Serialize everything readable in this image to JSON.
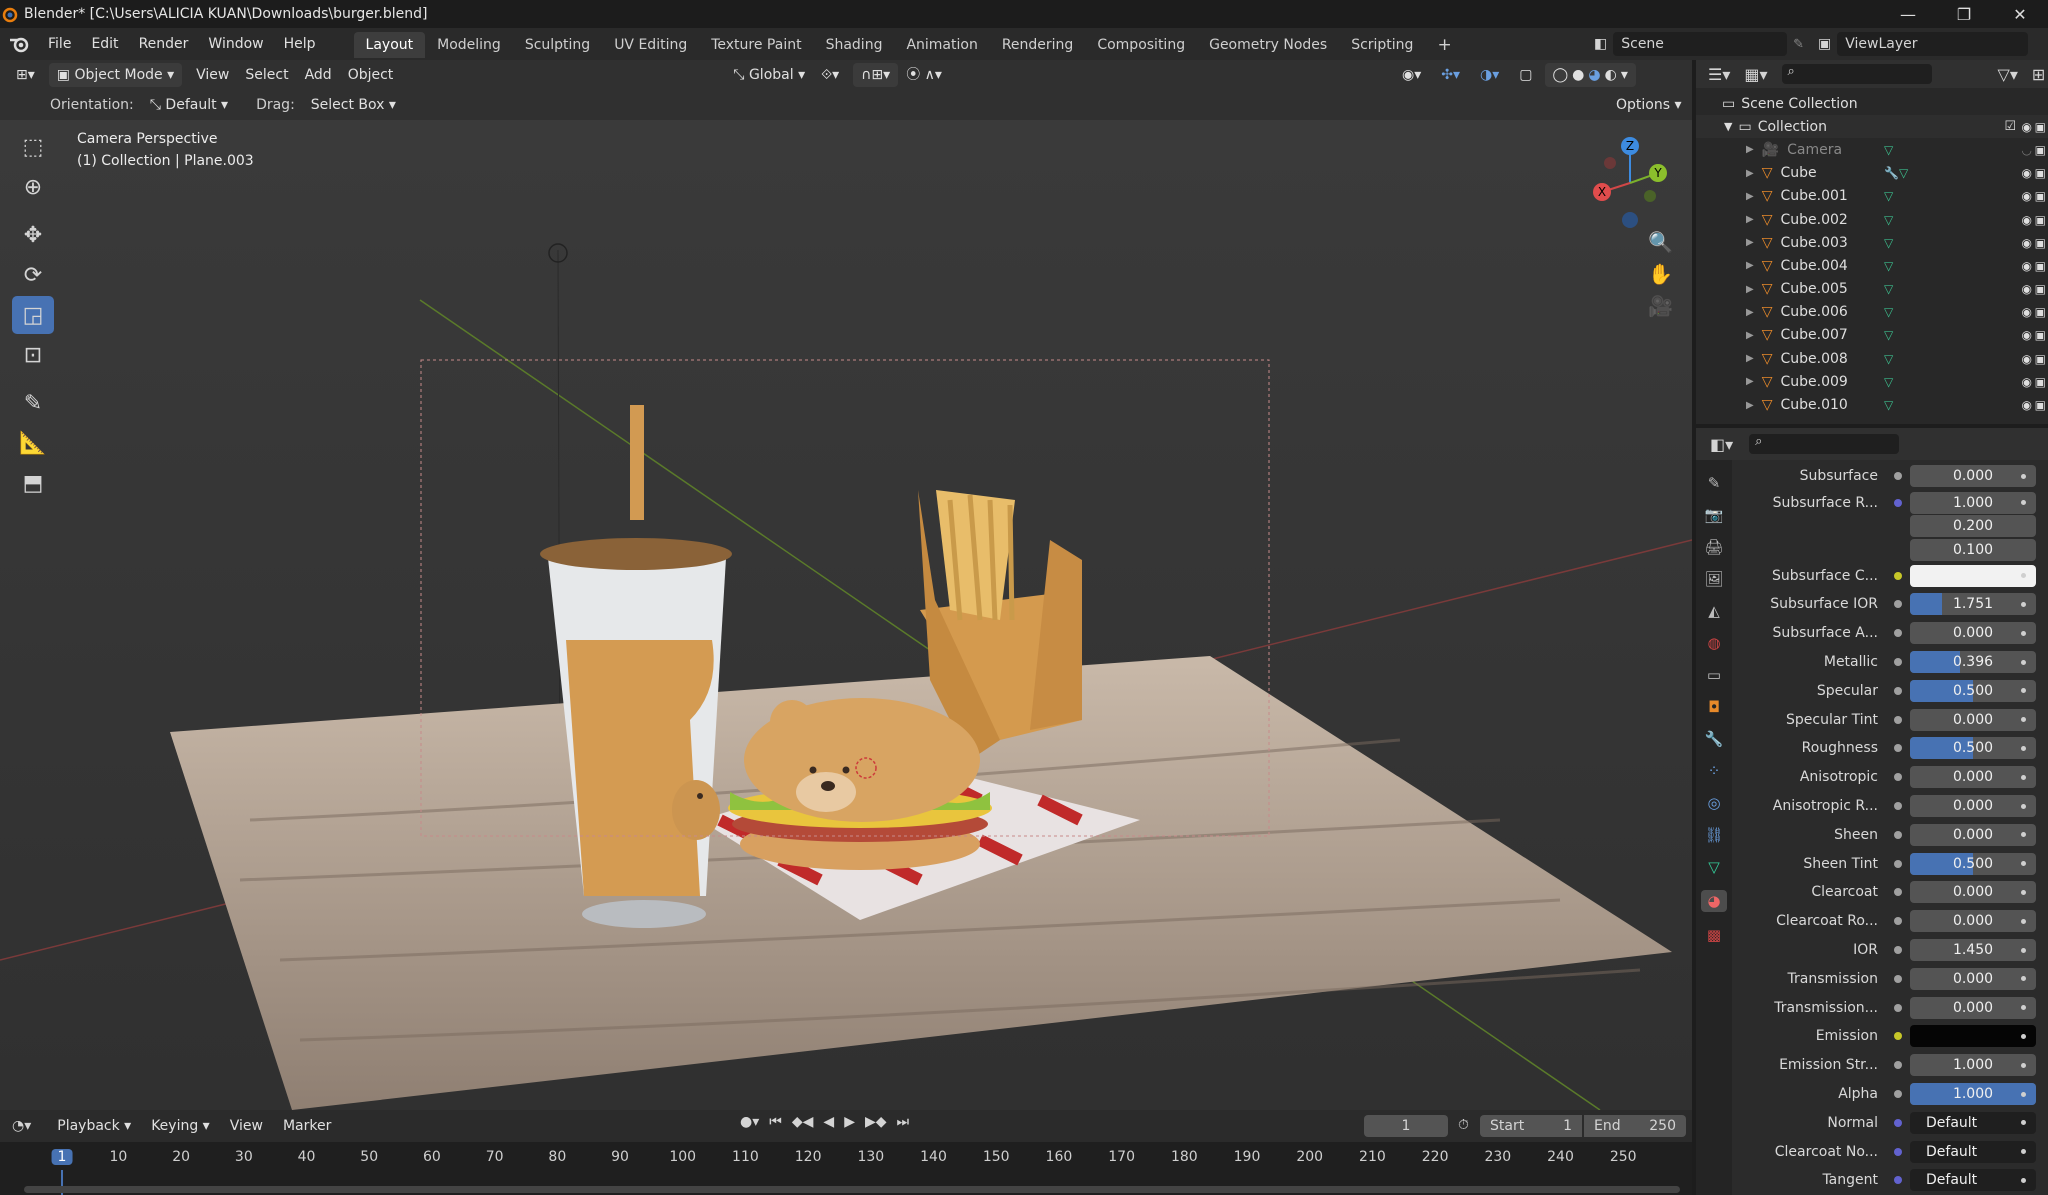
{
  "window": {
    "title": "Blender* [C:\\Users\\ALICIA KUAN\\Downloads\\burger.blend]"
  },
  "menu": {
    "items": [
      "File",
      "Edit",
      "Render",
      "Window",
      "Help"
    ]
  },
  "workspaces": {
    "tabs": [
      "Layout",
      "Modeling",
      "Sculpting",
      "UV Editing",
      "Texture Paint",
      "Shading",
      "Animation",
      "Rendering",
      "Compositing",
      "Geometry Nodes",
      "Scripting"
    ],
    "active": "Layout",
    "add": "+"
  },
  "scene": {
    "label": "Scene",
    "viewlayer": "ViewLayer"
  },
  "viewport_header": {
    "mode": "Object Mode",
    "menus": [
      "View",
      "Select",
      "Add",
      "Object"
    ],
    "transform": "Global"
  },
  "tool_header": {
    "orientation_label": "Orientation:",
    "orientation_value": "Default",
    "drag_label": "Drag:",
    "drag_value": "Select Box",
    "options": "Options"
  },
  "viewport": {
    "line1": "Camera Perspective",
    "line2": "(1) Collection | Plane.003",
    "gizmo": {
      "z": "Z",
      "y": "Y",
      "x": "X"
    }
  },
  "outliner": {
    "root": "Scene Collection",
    "collection": "Collection",
    "items": [
      "Camera",
      "Cube",
      "Cube.001",
      "Cube.002",
      "Cube.003",
      "Cube.004",
      "Cube.005",
      "Cube.006",
      "Cube.007",
      "Cube.008",
      "Cube.009",
      "Cube.010"
    ]
  },
  "properties": {
    "rows": [
      {
        "label": "Subsurface",
        "value": "0.000",
        "fill": 0
      },
      {
        "label": "Subsurface R...",
        "value": "1.000",
        "fill": 0,
        "dot": "p"
      },
      {
        "label": "",
        "value": "0.200",
        "fill": 0
      },
      {
        "label": "",
        "value": "0.100",
        "fill": 0
      },
      {
        "label": "Subsurface C...",
        "value": "",
        "color": "#f2f2f2",
        "dot": "y"
      },
      {
        "label": "Subsurface IOR",
        "value": "1.751",
        "fill": 0.25
      },
      {
        "label": "Subsurface A...",
        "value": "0.000",
        "fill": 0
      },
      {
        "label": "Metallic",
        "value": "0.396",
        "fill": 0.396
      },
      {
        "label": "Specular",
        "value": "0.500",
        "fill": 0.5
      },
      {
        "label": "Specular Tint",
        "value": "0.000",
        "fill": 0
      },
      {
        "label": "Roughness",
        "value": "0.500",
        "fill": 0.5
      },
      {
        "label": "Anisotropic",
        "value": "0.000",
        "fill": 0
      },
      {
        "label": "Anisotropic R...",
        "value": "0.000",
        "fill": 0
      },
      {
        "label": "Sheen",
        "value": "0.000",
        "fill": 0
      },
      {
        "label": "Sheen Tint",
        "value": "0.500",
        "fill": 0.5
      },
      {
        "label": "Clearcoat",
        "value": "0.000",
        "fill": 0
      },
      {
        "label": "Clearcoat Ro...",
        "value": "0.000",
        "fill": 0
      },
      {
        "label": "IOR",
        "value": "1.450",
        "fill": 0
      },
      {
        "label": "Transmission",
        "value": "0.000",
        "fill": 0
      },
      {
        "label": "Transmission...",
        "value": "0.000",
        "fill": 0
      },
      {
        "label": "Emission",
        "value": "",
        "color": "#050505",
        "dot": "y"
      },
      {
        "label": "Emission Str...",
        "value": "1.000",
        "fill": 0
      },
      {
        "label": "Alpha",
        "value": "1.000",
        "fill": 1
      },
      {
        "label": "Normal",
        "value": "Default",
        "link": true
      },
      {
        "label": "Clearcoat No...",
        "value": "Default",
        "link": true
      },
      {
        "label": "Tangent",
        "value": "Default",
        "link": true
      }
    ]
  },
  "timeline": {
    "menus": [
      "Playback",
      "Keying",
      "View",
      "Marker"
    ],
    "current": "1",
    "start_label": "Start",
    "start": "1",
    "end_label": "End",
    "end": "250",
    "marks": [
      "1",
      "10",
      "20",
      "30",
      "40",
      "50",
      "60",
      "70",
      "80",
      "90",
      "100",
      "110",
      "120",
      "130",
      "140",
      "150",
      "160",
      "170",
      "180",
      "190",
      "200",
      "210",
      "220",
      "230",
      "240",
      "250"
    ]
  },
  "colors": {
    "accent": "#4772b3",
    "background": "#393939",
    "panel": "#303030"
  }
}
